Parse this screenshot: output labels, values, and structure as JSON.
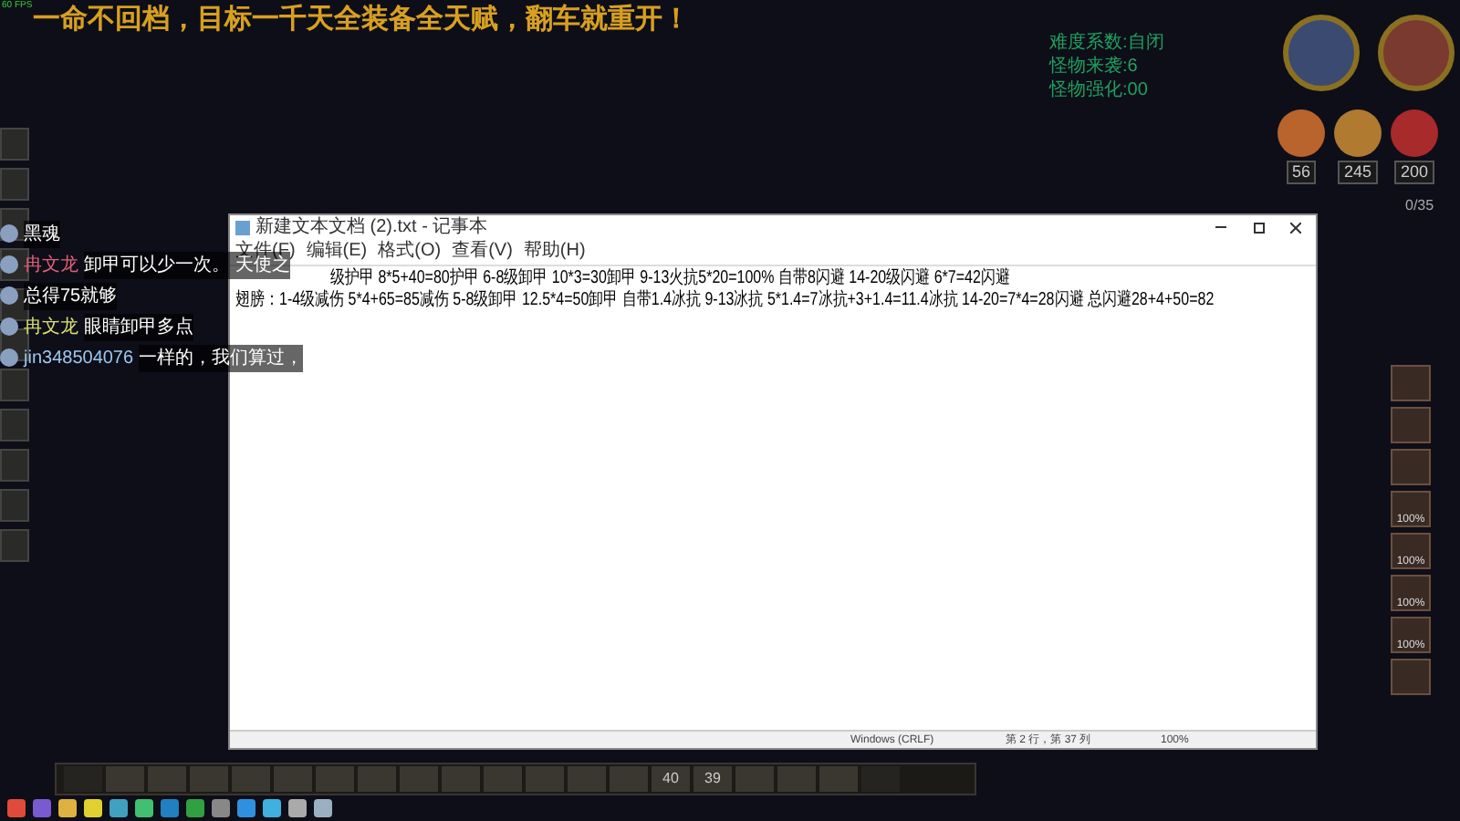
{
  "fps": "60 FPS",
  "stream_banner": "一命不回档，目标一千天全装备全天赋，翻车就重开！",
  "game_stats": [
    "难度系数:自闭",
    "怪物来袭:6",
    "怪物强化:00"
  ],
  "gauges": [
    {
      "value": "56",
      "color": "#b8642c"
    },
    {
      "value": "245",
      "color": "#b07a30"
    },
    {
      "value": "200",
      "color": "#a82a2a"
    }
  ],
  "naughtiness": "0/35",
  "chat": [
    {
      "message": "黑魂"
    },
    {
      "name": "冉文龙",
      "color": "#e0607a",
      "message": "卸甲可以少一次。 天使之"
    },
    {
      "message": "总得75就够"
    },
    {
      "name": "冉文龙",
      "color": "#d8e070",
      "message": "眼睛卸甲多点"
    },
    {
      "name": "jin348504076",
      "color": "#9cc8f0",
      "message": "一样的，我们算过，"
    }
  ],
  "notepad": {
    "title": "新建文本文档 (2).txt - 记事本",
    "menu": [
      "文件(F)",
      "编辑(E)",
      "格式(O)",
      "查看(V)",
      "帮助(H)"
    ],
    "lines": [
      "级护甲 8*5+40=80护甲  6-8级卸甲 10*3=30卸甲  9-13火抗5*20=100%  自带8闪避 14-20级闪避 6*7=42闪避",
      "翅膀：1-4级减伤 5*4+65=85减伤  5-8级卸甲 12.5*4=50卸甲 自带1.4冰抗 9-13冰抗 5*1.4=7冰抗+3+1.4=11.4冰抗 14-20=7*4=28闪避 总闪避28+4+50=82"
    ],
    "status": [
      "Windows (CRLF)",
      "第 2 行，第 37 列",
      "100%"
    ]
  },
  "inventory": [
    {
      "kind": "item"
    },
    {
      "kind": "item"
    },
    {
      "kind": "item"
    },
    {
      "kind": "item",
      "label": "100%"
    },
    {
      "kind": "item",
      "label": "100%"
    },
    {
      "kind": "item",
      "label": "100%"
    },
    {
      "kind": "item",
      "label": "100%"
    },
    {
      "kind": "item"
    }
  ],
  "hotbar": [
    {
      "kind": "empty"
    },
    {
      "kind": "item"
    },
    {
      "kind": "item"
    },
    {
      "kind": "item"
    },
    {
      "kind": "item"
    },
    {
      "kind": "item"
    },
    {
      "kind": "item"
    },
    {
      "kind": "item"
    },
    {
      "kind": "item"
    },
    {
      "kind": "item"
    },
    {
      "kind": "item"
    },
    {
      "kind": "item"
    },
    {
      "kind": "item"
    },
    {
      "kind": "item"
    },
    {
      "kind": "item",
      "label": "40"
    },
    {
      "kind": "item",
      "label": "39"
    },
    {
      "kind": "item"
    },
    {
      "kind": "item"
    },
    {
      "kind": "item"
    },
    {
      "kind": "empty"
    }
  ]
}
